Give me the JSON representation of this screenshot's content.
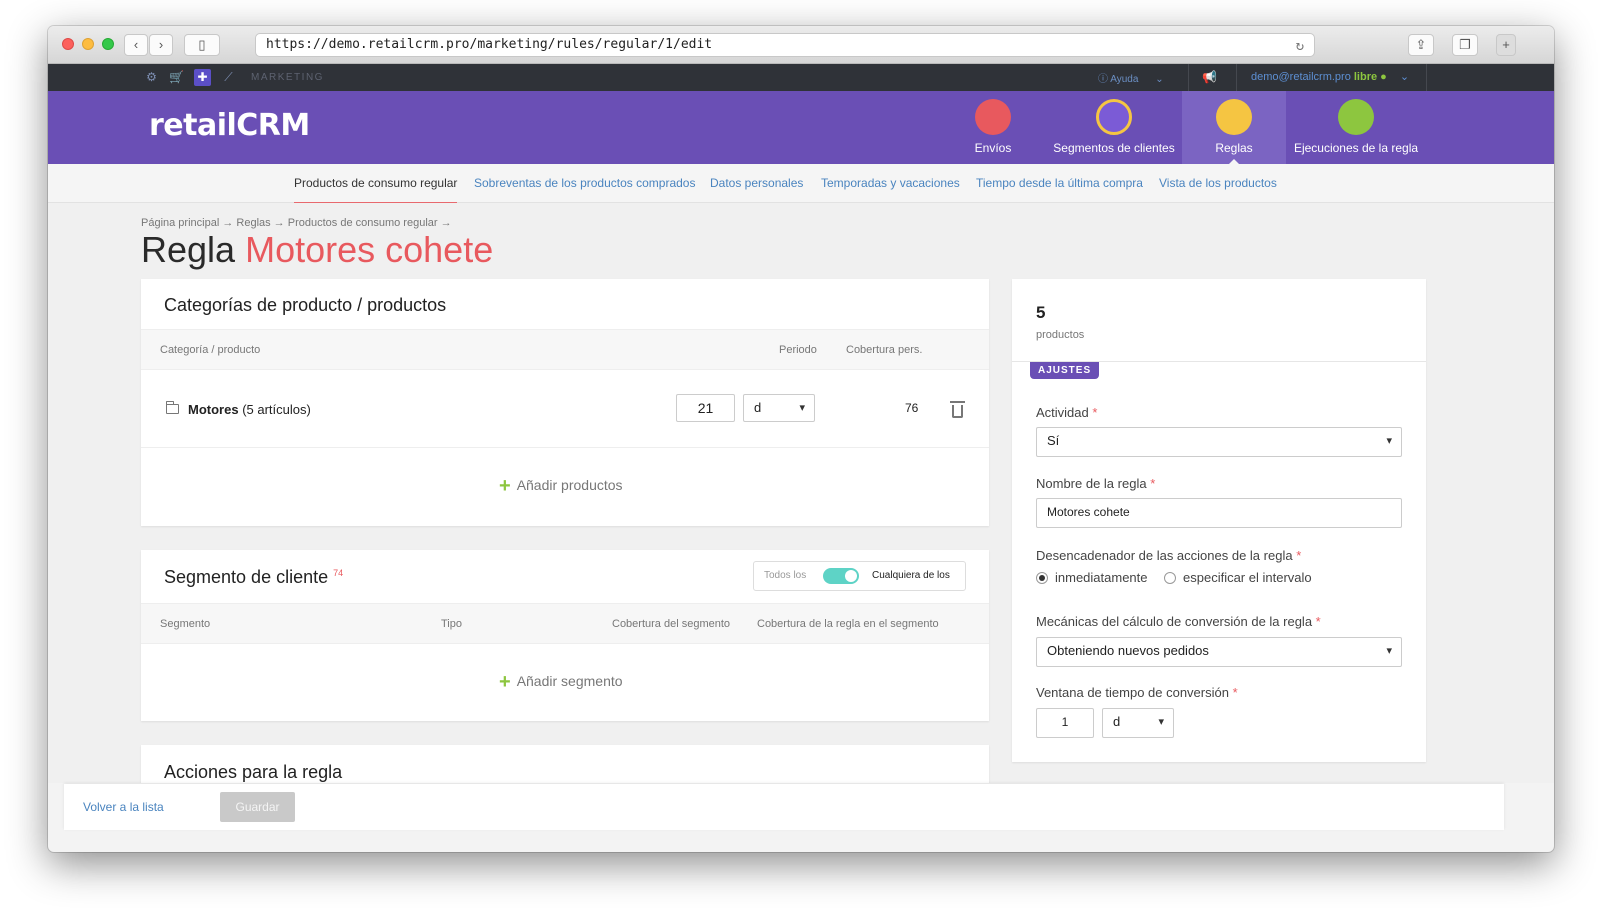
{
  "browser": {
    "url": "https://demo.retailcrm.pro/marketing/rules/regular/1/edit"
  },
  "topbar": {
    "section_label": "MARKETING",
    "help_label": "Ayuda",
    "user_email": "demo@retailcrm.pro",
    "user_status": "libre"
  },
  "header": {
    "logo_text": "retailCRM",
    "nav": [
      {
        "label": "Envíos",
        "color": "#e8595e"
      },
      {
        "label": "Segmentos de clientes",
        "color": "#7b5bd6"
      },
      {
        "label": "Reglas",
        "color": "#f5c542"
      },
      {
        "label": "Ejecuciones de la regla",
        "color": "#8dc63f"
      }
    ]
  },
  "subnav": [
    "Productos de consumo regular",
    "Sobreventas de los productos comprados",
    "Datos personales",
    "Temporadas y vacaciones",
    "Tiempo desde la última compra",
    "Vista de los productos"
  ],
  "breadcrumb": "Página principal → Reglas → Productos de consumo regular →",
  "title": {
    "prefix": "Regla",
    "name": "Motores cohete"
  },
  "products_card": {
    "title": "Categorías de producto / productos",
    "columns": [
      "Categoría / producto",
      "Periodo",
      "Cobertura pers."
    ],
    "row": {
      "name": "Motores",
      "count": "(5 artículos)",
      "period_value": "21",
      "period_unit": "d",
      "coverage": "76"
    },
    "add_label": "Añadir productos"
  },
  "segment_card": {
    "title": "Segmento de cliente",
    "count": "74",
    "toggle_left": "Todos los",
    "toggle_right": "Cualquiera de los",
    "columns": [
      "Segmento",
      "Tipo",
      "Cobertura del segmento",
      "Cobertura de la regla en el segmento"
    ],
    "add_label": "Añadir segmento"
  },
  "actions_card": {
    "title": "Acciones para la regla"
  },
  "right_panel": {
    "count": "5",
    "count_label": "productos",
    "badge": "AJUSTES",
    "activity_label": "Actividad",
    "activity_value": "Sí",
    "name_label": "Nombre de la regla",
    "name_value": "Motores cohete",
    "trigger_label": "Desencadenador de las acciones de la regla",
    "trigger_opt1": "inmediatamente",
    "trigger_opt2": "especificar el intervalo",
    "mechanics_label": "Mecánicas del cálculo de conversión de la regla",
    "mechanics_value": "Obteniendo nuevos pedidos",
    "window_label": "Ventana de tiempo de conversión",
    "window_value": "1",
    "window_unit": "d"
  },
  "footer": {
    "back_label": "Volver a la lista",
    "save_label": "Guardar"
  }
}
